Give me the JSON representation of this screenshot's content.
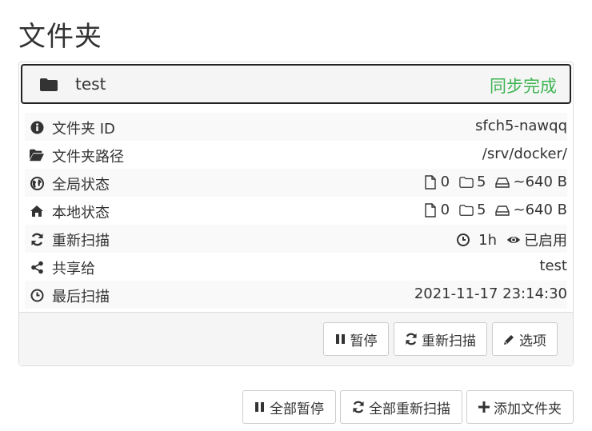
{
  "page": {
    "title": "文件夹"
  },
  "folder": {
    "label": "test",
    "status": "同步完成",
    "status_color": "#3fb553",
    "icon": "folder-icon"
  },
  "details": {
    "folder_id": {
      "label": "文件夹 ID",
      "value": "sfch5-nawqq",
      "icon": "info-icon"
    },
    "folder_path": {
      "label": "文件夹路径",
      "value": "/srv/docker/",
      "icon": "folder-open-icon"
    },
    "global_state": {
      "label": "全局状态",
      "files": "0",
      "dirs": "5",
      "size": "~640 B",
      "icon": "globe-icon"
    },
    "local_state": {
      "label": "本地状态",
      "files": "0",
      "dirs": "5",
      "size": "~640 B",
      "icon": "home-icon"
    },
    "rescan": {
      "label": "重新扫描",
      "interval": "1h",
      "watcher": "已启用",
      "icon": "refresh-icon"
    },
    "shared_with": {
      "label": "共享给",
      "value": "test",
      "icon": "share-icon"
    },
    "last_scan": {
      "label": "最后扫描",
      "value": "2021-11-17 23:14:30",
      "icon": "clock-icon"
    }
  },
  "folder_actions": {
    "pause": "暂停",
    "rescan": "重新扫描",
    "options": "选项"
  },
  "global_actions": {
    "pause_all": "全部暂停",
    "rescan_all": "全部重新扫描",
    "add_folder": "添加文件夹"
  }
}
